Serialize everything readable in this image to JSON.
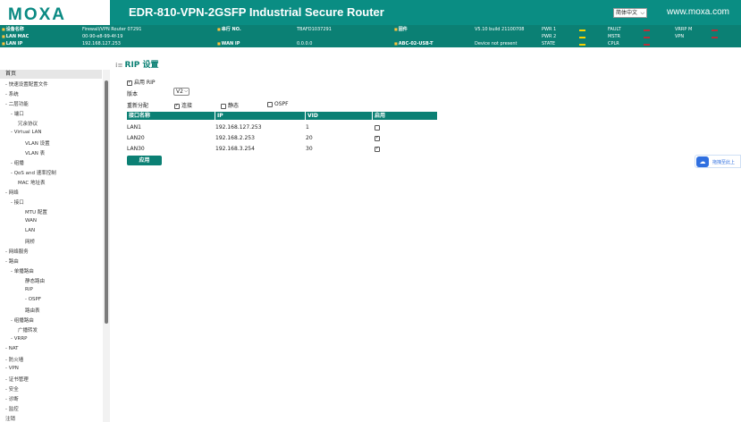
{
  "header": {
    "logo": "MOXA",
    "title": "EDR-810-VPN-2GSFP Industrial Secure Router",
    "language": "简体中文",
    "site": "www.moxa.com"
  },
  "info": {
    "device_name_label": "设备名称",
    "device_name": "Firewall/VPN Router 07291",
    "serial_label": "串行 NO.",
    "serial": "TBAFD1037291",
    "firmware_label": "固件",
    "firmware": "V5.10 build 21100708",
    "lan_mac_label": "LAN MAC",
    "lan_mac": "00-90-e8-99-4f-19",
    "lan_ip_label": "LAN IP",
    "lan_ip": "192.168.127.253",
    "wan_ip_label": "WAN IP",
    "wan_ip": "0.0.0.0",
    "abc_label": "ABC-02-USB-T",
    "abc_value": "Device not present",
    "status": [
      {
        "label": "PWR 1",
        "color": "#f6d200"
      },
      {
        "label": "PWR 2",
        "color": "#f6d200"
      },
      {
        "label": "STATE",
        "color": "#f6d200"
      },
      {
        "label": "FAULT",
        "color": "#b6303a"
      },
      {
        "label": "MSTR",
        "color": "#b6303a"
      },
      {
        "label": "CPLR",
        "color": "#b6303a"
      },
      {
        "label": "VRRP M",
        "color": "#b6303a"
      },
      {
        "label": "VPN",
        "color": "#b6303a"
      }
    ]
  },
  "sidebar": {
    "home": "首页",
    "items": [
      "- 快速设置配置文件",
      "- 系统",
      "- 二层功能",
      "- 端口",
      "冗余协议",
      "- Virtual LAN",
      "VLAN 设置",
      "VLAN 表",
      "- 组播",
      "- QoS and 速率控制",
      "MAC 地址表",
      "- 网络",
      "- 接口",
      "MTU 配置",
      "WAN",
      "LAN",
      "网桥",
      "- 网络服务",
      "- 路由",
      "- 单播路由",
      "静态路由",
      "RIP",
      "- OSPF",
      "路由表",
      "- 组播路由",
      "广播转发",
      "- VRRP",
      "- NAT",
      "- 防火墙",
      "- VPN",
      "- 证书管理",
      "- 安全",
      "- 诊断",
      "- 监控",
      "注销"
    ]
  },
  "main": {
    "title": "RIP 设置",
    "enable_rip": "启用 RIP",
    "version_label": "版本",
    "version_value": "V2",
    "redistribution_label": "重新分配",
    "redist_connected": "连接",
    "redist_static": "静态",
    "redist_ospf": "OSPF",
    "table": {
      "headers": [
        "接口名称",
        "IP",
        "VID",
        "启用"
      ],
      "rows": [
        {
          "name": "LAN1",
          "ip": "192.168.127.253",
          "vid": "1",
          "enabled": false
        },
        {
          "name": "LAN20",
          "ip": "192.168.2.253",
          "vid": "20",
          "enabled": true
        },
        {
          "name": "LAN30",
          "ip": "192.168.3.254",
          "vid": "30",
          "enabled": true
        }
      ]
    },
    "apply": "应用"
  },
  "float_widget": {
    "label": "拖拽至此上"
  }
}
